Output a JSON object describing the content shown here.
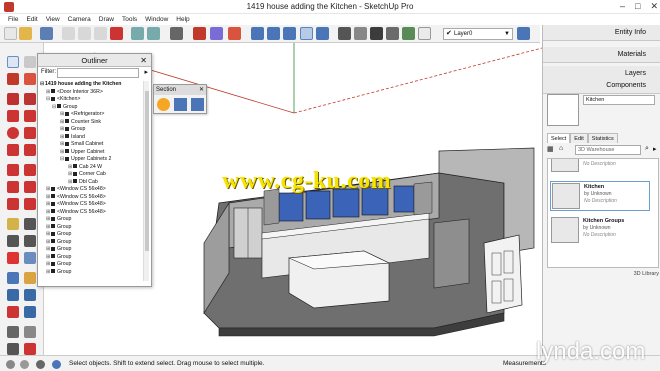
{
  "window": {
    "title": "1419 house adding the Kitchen - SketchUp Pro",
    "controls": [
      "–",
      "□",
      "✕"
    ]
  },
  "menu": [
    "File",
    "Edit",
    "View",
    "Camera",
    "Draw",
    "Tools",
    "Window",
    "Help"
  ],
  "toolbar": {
    "layer_value": "Layer0"
  },
  "outliner": {
    "title": "Outliner",
    "filter_label": "Filter:",
    "tree": [
      {
        "label": "1419 house adding the Kitchen",
        "expander": "⊟",
        "top": true
      },
      {
        "label": "<Door Interior 36R>",
        "expander": "⊞"
      },
      {
        "label": "<Kitchen>",
        "expander": "⊟"
      },
      {
        "label": "Group",
        "expander": "⊟"
      },
      {
        "label": "<Refrigerator>",
        "expander": "⊞"
      },
      {
        "label": "Counter Sink",
        "expander": "⊞"
      },
      {
        "label": "Group",
        "expander": "⊞"
      },
      {
        "label": "Island",
        "expander": "⊞"
      },
      {
        "label": "Small Cabinet",
        "expander": "⊞"
      },
      {
        "label": "Upper Cabinet",
        "expander": "⊞"
      },
      {
        "label": "Upper Cabinets 2",
        "expander": "⊟"
      },
      {
        "label": "Cab 24 W",
        "expander": "⊞"
      },
      {
        "label": "Corner Cab",
        "expander": "⊞"
      },
      {
        "label": "Dbl Cab",
        "expander": "⊞"
      },
      {
        "label": "<Window CS 56x48>",
        "expander": "⊞"
      },
      {
        "label": "<Window CS 56x48>",
        "expander": "⊞"
      },
      {
        "label": "<Window CS 56x48>",
        "expander": "⊞"
      },
      {
        "label": "<Window CS 56x48>",
        "expander": "⊞"
      },
      {
        "label": "Group",
        "expander": "⊞"
      },
      {
        "label": "Group",
        "expander": "⊞"
      },
      {
        "label": "Group",
        "expander": "⊞"
      },
      {
        "label": "Group",
        "expander": "⊞"
      },
      {
        "label": "Group",
        "expander": "⊞"
      },
      {
        "label": "Group",
        "expander": "⊞"
      },
      {
        "label": "Group",
        "expander": "⊞"
      },
      {
        "label": "Group",
        "expander": "⊞"
      }
    ]
  },
  "section_toolbar": {
    "title": "Section"
  },
  "tray": {
    "tabs": [
      "Entity Info",
      "Materials",
      "Layers",
      "Components"
    ],
    "component_name": "Kitchen",
    "sub_tabs": [
      "Select",
      "Edit",
      "Statistics"
    ],
    "search_placeholder": "3D Warehouse",
    "items": [
      {
        "name": "",
        "by": "",
        "desc": "No Description"
      },
      {
        "name": "Kitchen",
        "by": "by Unknown",
        "desc": "No Description"
      },
      {
        "name": "Kitchen Groups",
        "by": "by Unknown",
        "desc": "No Description"
      }
    ],
    "library_label": "3D Library"
  },
  "status": {
    "hint": "Select objects. Shift to extend select. Drag mouse to select multiple.",
    "measurements_label": "Measurements"
  },
  "watermarks": {
    "site": "www.cg-ku.com",
    "brand": "lynda.com"
  },
  "colors": {
    "accent_blue": "#3a78c2",
    "watermark_yellow": "#f6e400",
    "model_gray": "#9a9a9a",
    "window_blue": "#3b63b8"
  }
}
